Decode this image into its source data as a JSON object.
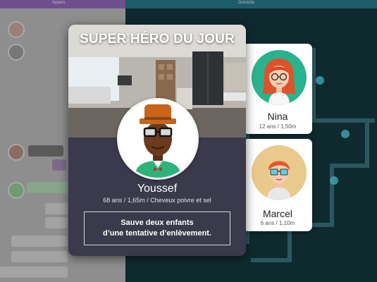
{
  "background": {
    "left_header": "Appels",
    "right_header": "Domicile"
  },
  "hero_card": {
    "title": "SUPER HÉRO DU JOUR",
    "name": "Youssef",
    "info": "68 ans / 1,65m / Cheveux poivre et sel",
    "deed_line1": "Sauve deux enfants",
    "deed_line2": "d’une tentative d’enlèvement."
  },
  "people": [
    {
      "name": "Nina",
      "info": "12 ans / 1,50m"
    },
    {
      "name": "Marcel",
      "info": "6 ans / 1,10m"
    }
  ],
  "colors": {
    "card_bg": "#3a3a4c",
    "nina_circle": "#2bb28e",
    "marcel_circle": "#e9c98c",
    "hero_skin": "#6b3a1f"
  }
}
